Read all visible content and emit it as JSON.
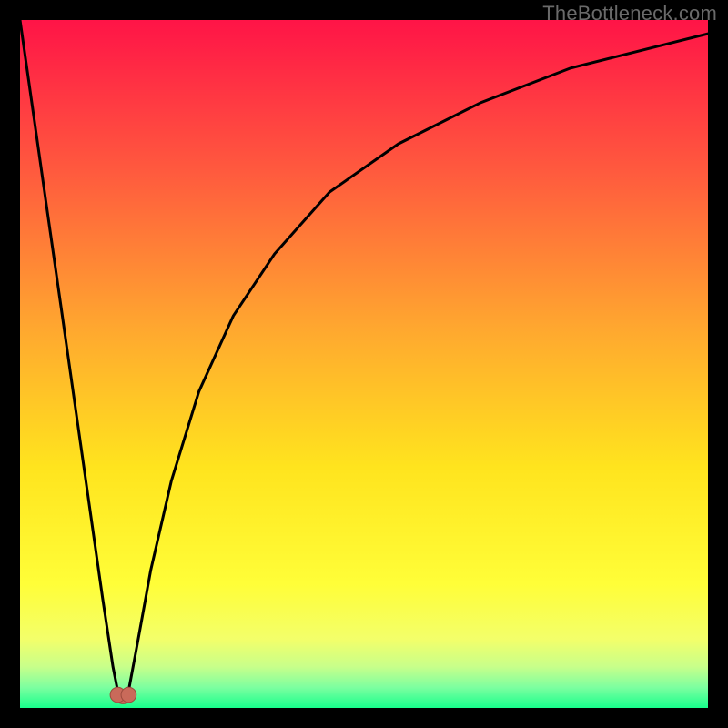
{
  "watermark": "TheBottleneck.com",
  "chart_data": {
    "type": "line",
    "title": "",
    "xlabel": "",
    "ylabel": "",
    "xlim": [
      0,
      100
    ],
    "ylim": [
      0,
      100
    ],
    "grid": false,
    "legend": false,
    "background": {
      "type": "vertical-gradient",
      "stops": [
        {
          "pos": 0.0,
          "color": "#ff1447"
        },
        {
          "pos": 0.22,
          "color": "#ff5a3e"
        },
        {
          "pos": 0.45,
          "color": "#ffa82f"
        },
        {
          "pos": 0.65,
          "color": "#ffe41e"
        },
        {
          "pos": 0.82,
          "color": "#fffe38"
        },
        {
          "pos": 0.9,
          "color": "#f3ff6a"
        },
        {
          "pos": 0.94,
          "color": "#c8ff8a"
        },
        {
          "pos": 0.97,
          "color": "#7dffa0"
        },
        {
          "pos": 1.0,
          "color": "#18ff8c"
        }
      ]
    },
    "series": [
      {
        "name": "curve-left",
        "x": [
          0,
          2,
          4,
          6,
          8,
          10,
          12,
          13.5,
          14.5
        ],
        "y": [
          100,
          86,
          72,
          58,
          44,
          30,
          16,
          6,
          1
        ]
      },
      {
        "name": "curve-right",
        "x": [
          15.5,
          17,
          19,
          22,
          26,
          31,
          37,
          45,
          55,
          67,
          80,
          92,
          100
        ],
        "y": [
          1,
          9,
          20,
          33,
          46,
          57,
          66,
          75,
          82,
          88,
          93,
          96,
          98
        ]
      }
    ],
    "marker": {
      "name": "heart-marker",
      "x": 15,
      "y": 1.5,
      "color": "#c96a5a",
      "size": 26
    }
  }
}
